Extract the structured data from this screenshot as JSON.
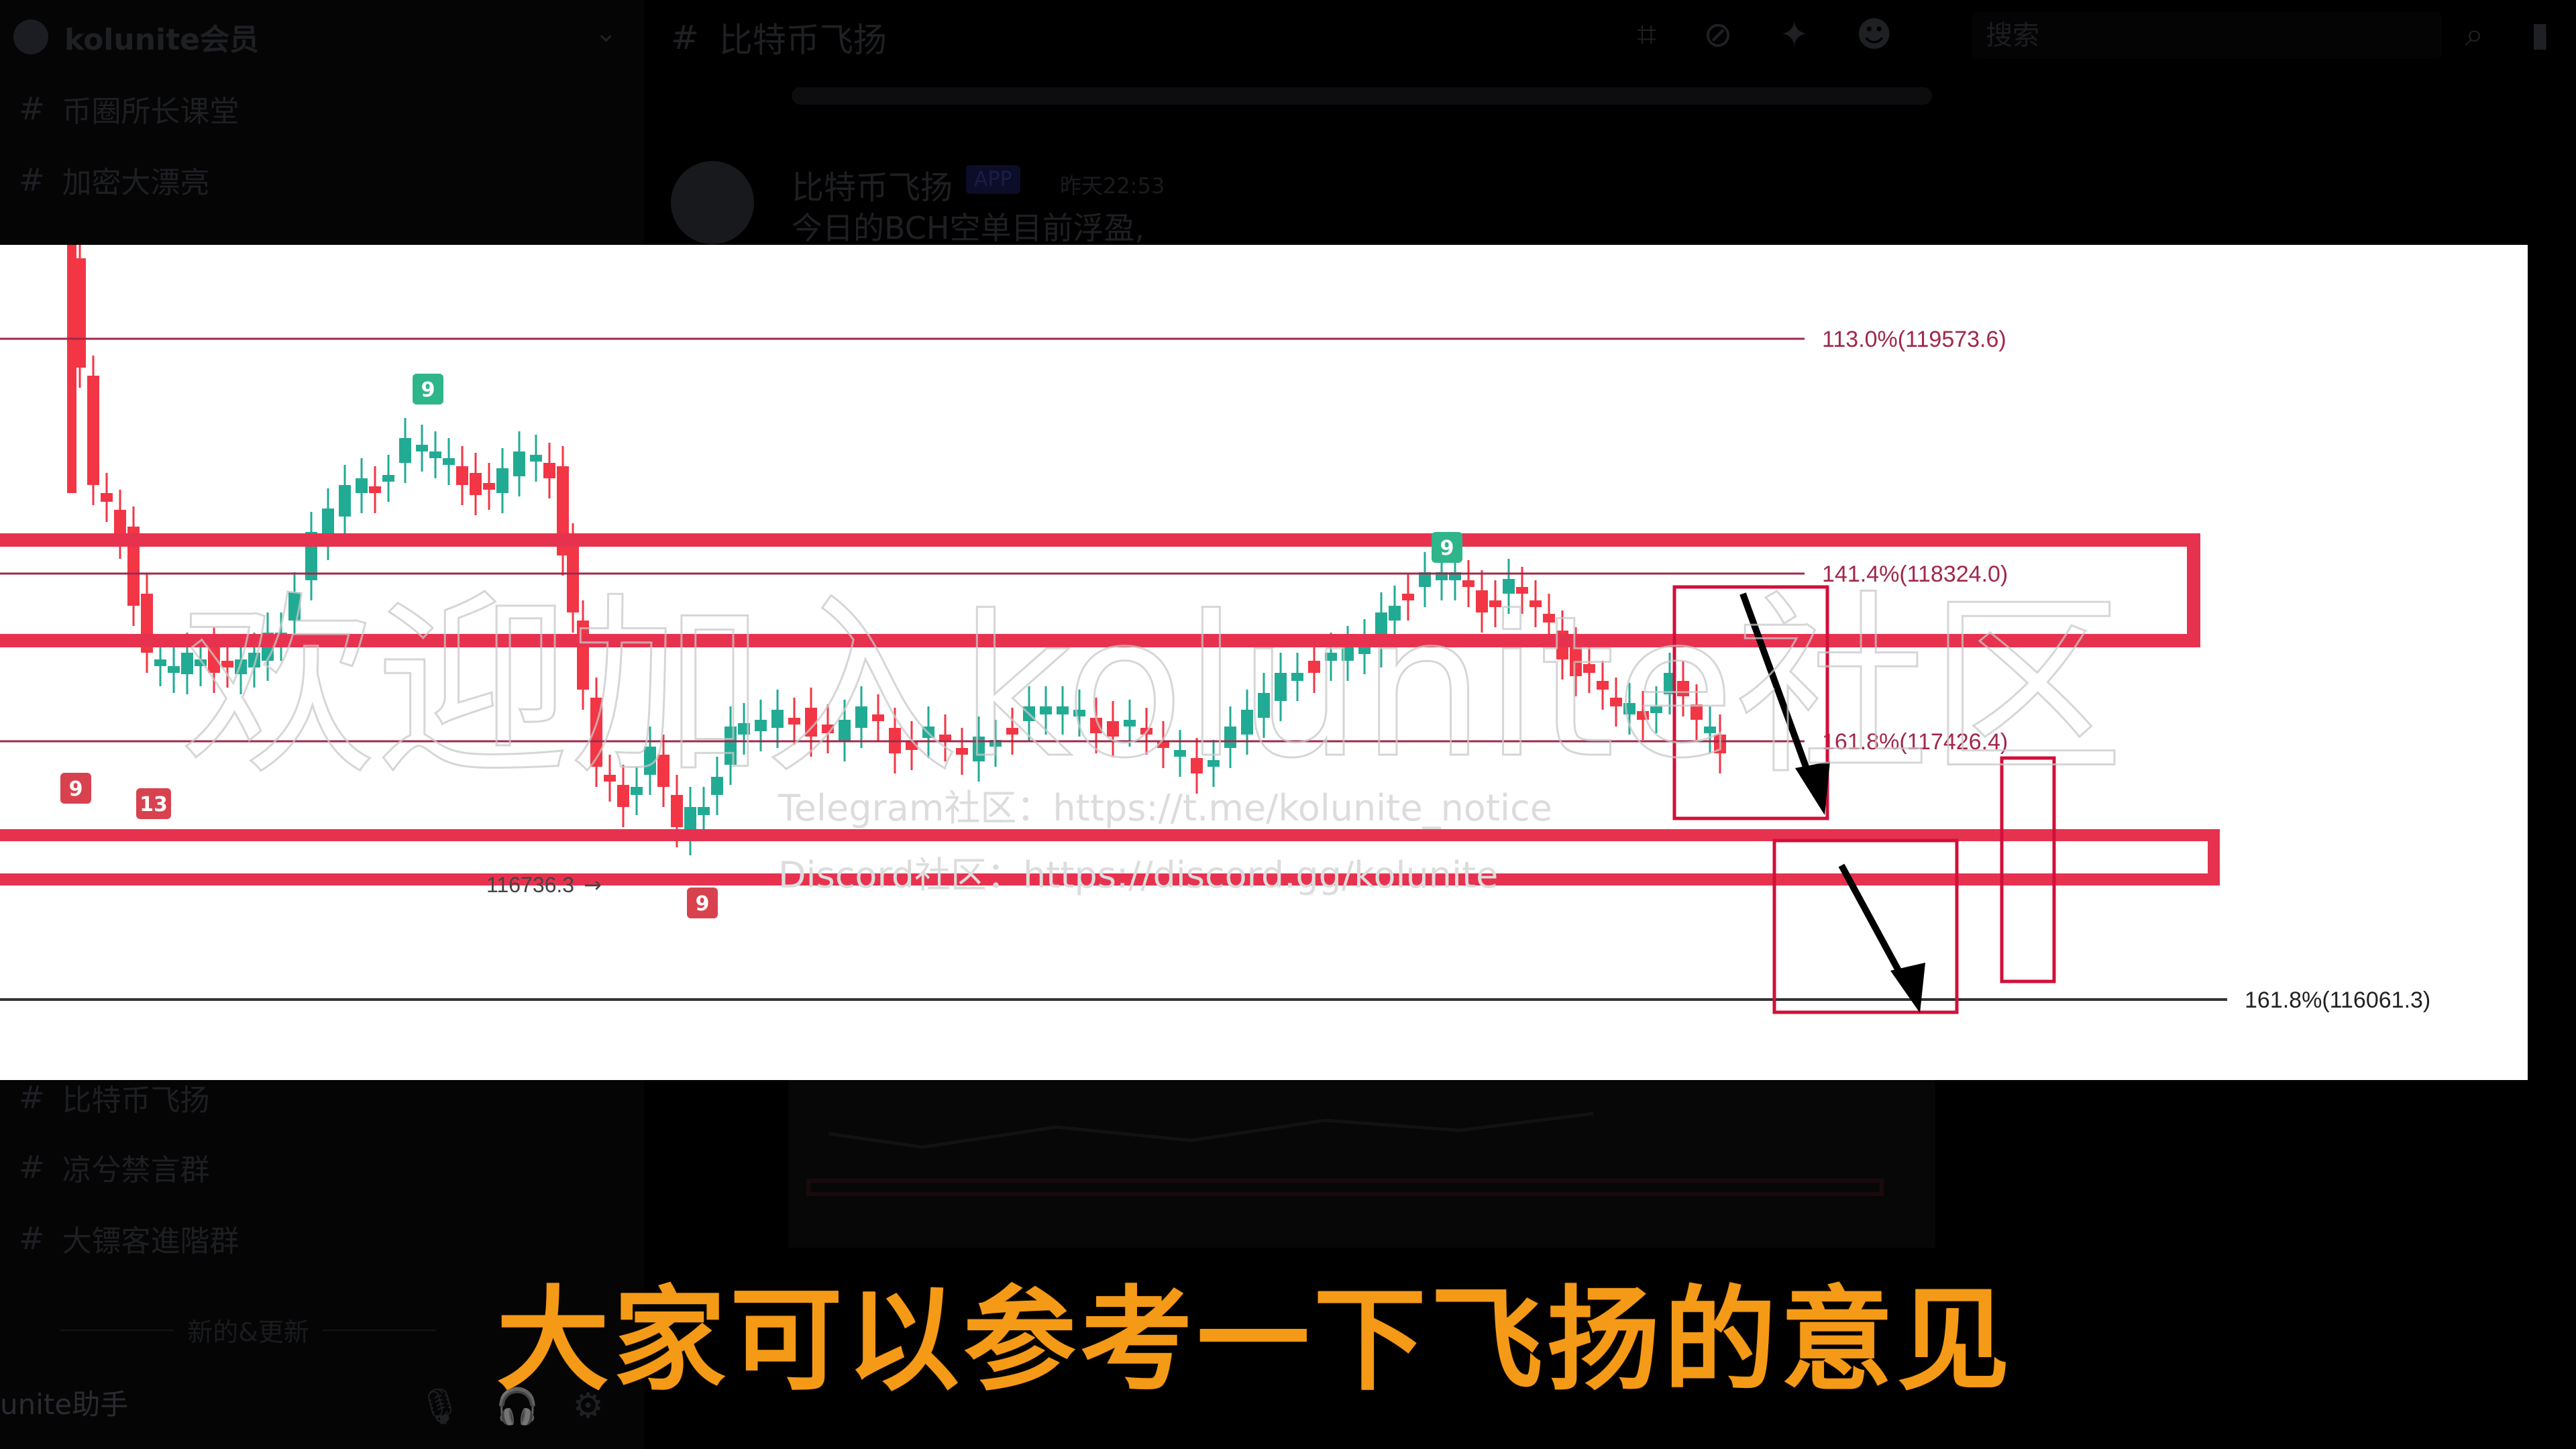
{
  "server": {
    "name": "kolunite会员",
    "chevron_icon": "chevron-down-icon"
  },
  "sidebar": {
    "channels_top": [
      {
        "label": "币圈所长课堂"
      },
      {
        "label": "加密大漂亮"
      },
      {
        "label": "…"
      }
    ],
    "channels_bottom": [
      {
        "label": "比特币飞扬"
      },
      {
        "label": "凉兮禁言群"
      },
      {
        "label": "大镖客進階群"
      }
    ],
    "divider_label": "新的&更新",
    "user": {
      "name": "unite助手",
      "icons": [
        "microphone-icon",
        "headphones-icon",
        "gear-icon"
      ]
    }
  },
  "topbar": {
    "channel_name": "比特币飞扬",
    "search_placeholder": "搜索",
    "icons": [
      "threads-icon",
      "mute-icon",
      "pin-icon",
      "members-icon",
      "search-icon",
      "bookmark-icon"
    ]
  },
  "message": {
    "author": "比特币飞扬",
    "tag": "APP",
    "time": "昨天22:53",
    "text": "今日的BCH空单目前浮盈,"
  },
  "chart": {
    "fib_labels": [
      {
        "text": "113.0%(119573.6)",
        "color": "#a0284a"
      },
      {
        "text": "141.4%(118324.0)",
        "color": "#a0284a"
      },
      {
        "text": "161.8%(117426.4)",
        "color": "#a0284a"
      },
      {
        "text": "161.8%(116061.3)",
        "color": "#222222"
      }
    ],
    "low_label": "116736.3",
    "markers": [
      "9",
      "13",
      "9",
      "9",
      "9"
    ],
    "watermark": "欢迎加入kolunite社区",
    "links": [
      "Telegram社区：https://t.me/kolunite_notice",
      "Discord社区：https://discord.gg/kolunite"
    ],
    "colors": {
      "up": "#22ab94",
      "down": "#f23645",
      "box": "#e0294a",
      "zone": "#e7324f"
    }
  },
  "caption": "大家可以参考一下飞扬的意见"
}
